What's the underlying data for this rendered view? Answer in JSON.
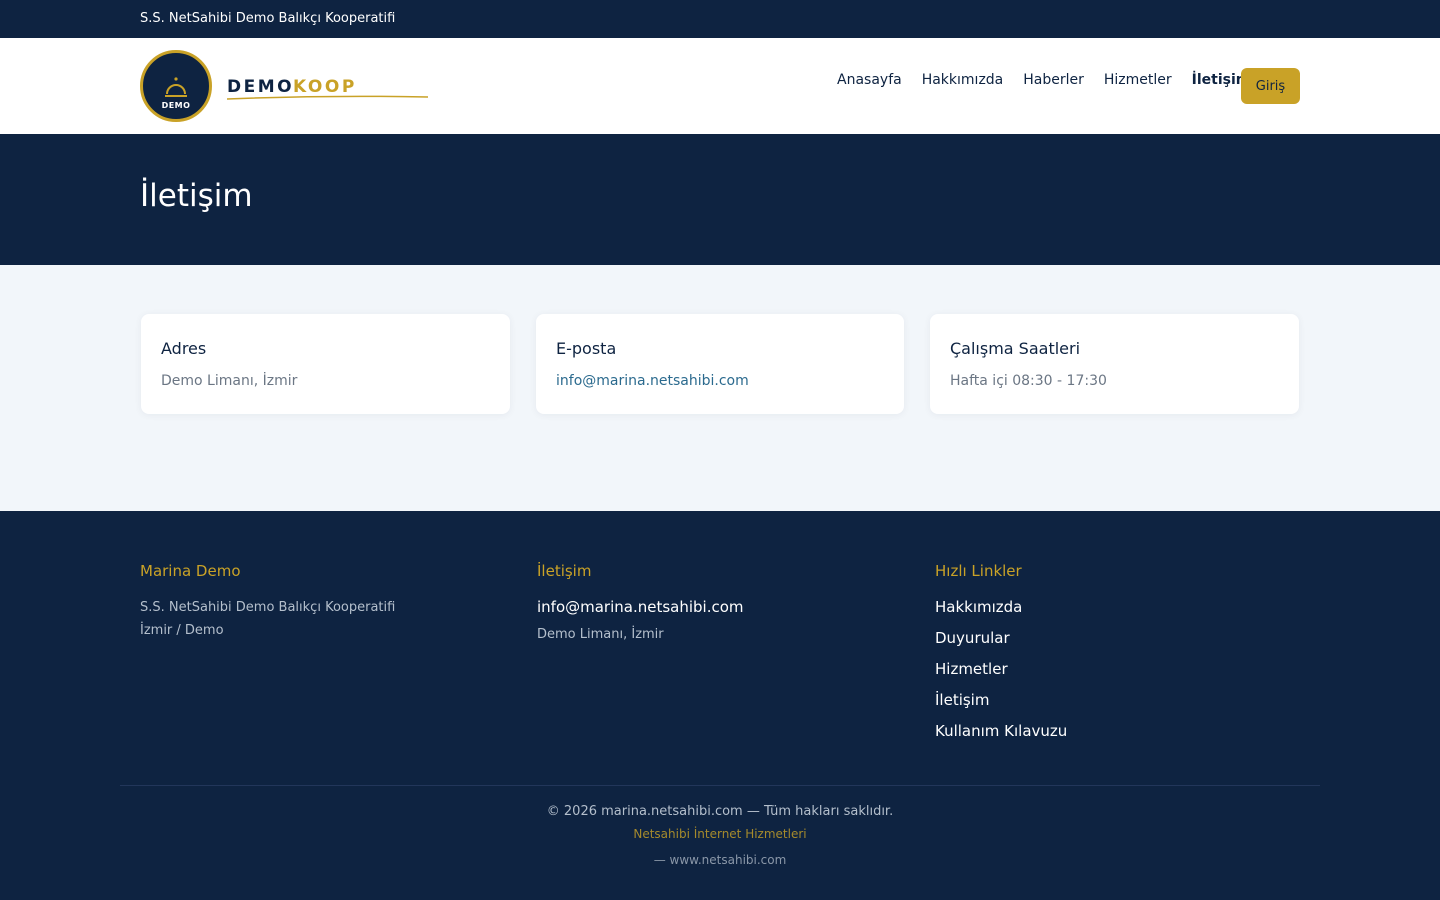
{
  "topbar": {
    "org_name": "S.S. NetSahibi Demo Balıkçı Kooperatifi"
  },
  "logo": {
    "badge_text": "DEMO",
    "brand_word1": "DEMO",
    "brand_word2": "KOOP"
  },
  "nav": {
    "items": [
      "Anasayfa",
      "Hakkımızda",
      "Haberler",
      "Hizmetler",
      "İletişim"
    ],
    "active": "İletişim",
    "login_label": "Giriş"
  },
  "hero": {
    "title": "İletişim"
  },
  "cards": [
    {
      "title": "Adres",
      "value": "Demo Limanı, İzmir"
    },
    {
      "title": "E-posta",
      "value": "info@marina.netsahibi.com"
    },
    {
      "title": "Çalışma Saatleri",
      "value": "Hafta içi 08:30 - 17:30"
    }
  ],
  "footer": {
    "col1": {
      "title": "Marina Demo",
      "line1": "S.S. NetSahibi Demo Balıkçı Kooperatifi",
      "line2": "İzmir / Demo"
    },
    "col2": {
      "title": "İletişim",
      "email": "info@marina.netsahibi.com",
      "address": "Demo Limanı, İzmir"
    },
    "col3": {
      "title": "Hızlı Linkler",
      "links": [
        "Hakkımızda",
        "Duyurular",
        "Hizmetler",
        "İletişim",
        "Kullanım Kılavuzu"
      ]
    },
    "copyright": "© 2026 marina.netsahibi.com — Tüm hakları saklıdır.",
    "provider": "Netsahibi İnternet Hizmetleri",
    "provider_url": "— www.netsahibi.com"
  },
  "colors": {
    "navy": "#0e2341",
    "gold": "#c9a227",
    "page_bg": "#f2f6fa",
    "link": "#2b6a8e"
  },
  "icons": {
    "logo_emblem": "service-bell-icon"
  }
}
